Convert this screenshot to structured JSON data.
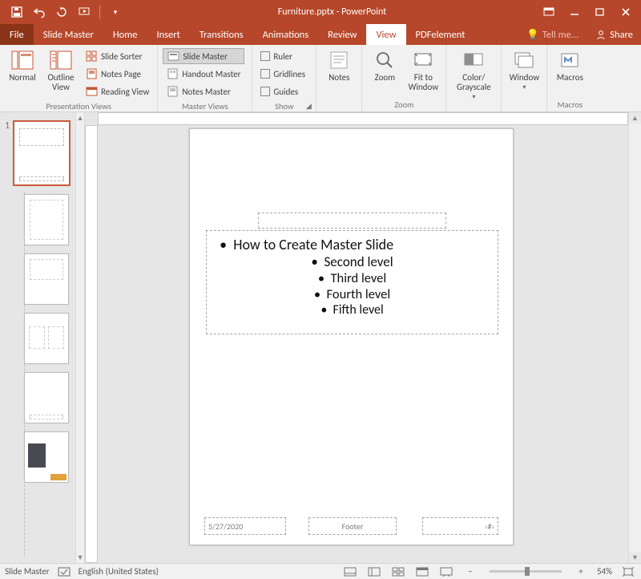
{
  "titlebar": {
    "title": "Furniture.pptx - PowerPoint"
  },
  "tabs": {
    "file": "File",
    "items": [
      "Slide Master",
      "Home",
      "Insert",
      "Transitions",
      "Animations",
      "Review",
      "View",
      "PDFelement"
    ],
    "active": "View",
    "tell_me": "Tell me...",
    "share": "Share"
  },
  "ribbon": {
    "presentation_views": {
      "label": "Presentation Views",
      "normal": "Normal",
      "outline": "Outline\nView",
      "slide_sorter": "Slide Sorter",
      "notes_page": "Notes Page",
      "reading_view": "Reading View"
    },
    "master_views": {
      "label": "Master Views",
      "slide_master": "Slide Master",
      "handout_master": "Handout Master",
      "notes_master": "Notes Master"
    },
    "show": {
      "label": "Show",
      "ruler": "Ruler",
      "gridlines": "Gridlines",
      "guides": "Guides"
    },
    "notes": {
      "label": "Notes"
    },
    "zoom": {
      "label": "Zoom",
      "zoom_btn": "Zoom",
      "fit": "Fit to\nWindow"
    },
    "color": {
      "label": "Color/\nGrayscale"
    },
    "window": {
      "label": "Window"
    },
    "macros": {
      "label": "Macros",
      "group": "Macros"
    }
  },
  "thumbs": {
    "number": "1"
  },
  "slide": {
    "bullets": {
      "l1": "How to Create Master Slide",
      "l2": "Second level",
      "l3": "Third level",
      "l4": "Fourth level",
      "l5": "Fifth level"
    },
    "date": "5/27/2020",
    "footer": "Footer",
    "pagenum": "‹#›"
  },
  "status": {
    "mode": "Slide Master",
    "language": "English (United States)",
    "zoom": "54%"
  }
}
